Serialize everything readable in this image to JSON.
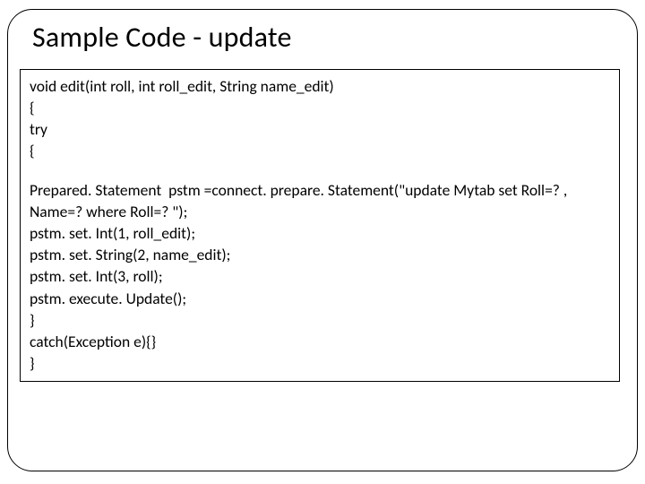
{
  "title": "Sample Code - update",
  "code": {
    "l1": "void edit(int roll, int roll_edit, String name_edit)",
    "l2": "{",
    "l3": "try",
    "l4": "{",
    "l5": "Prepared. Statement  pstm =connect. prepare. Statement(\"update Mytab set Roll=? , Name=? where Roll=? \");",
    "l6": "pstm. set. Int(1, roll_edit);",
    "l7": "pstm. set. String(2, name_edit);",
    "l8": "pstm. set. Int(3, roll);",
    "l9": "pstm. execute. Update();",
    "l10": "}",
    "l11": "catch(Exception e){}",
    "l12": "}"
  }
}
